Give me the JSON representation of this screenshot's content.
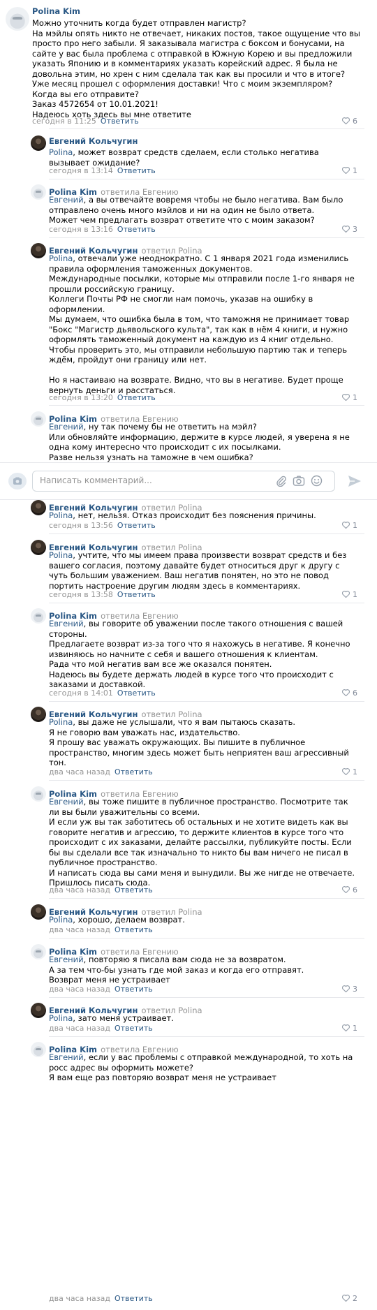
{
  "composer": {
    "placeholder": "Написать комментарий..."
  },
  "comments": [
    {
      "author": "Polina Kim",
      "replied": "",
      "mention": "",
      "text": "Можно уточнить когда будет отправлен магистр?\nНа мэйлы опять никто не отвечает, никаких постов, такое ощущение что вы просто про него забыли. Я заказывала магистра с боксом и бонусами, на сайте у вас была проблема с отправкой в Южную Корею и вы предложили указать Японию и в комментариях указать корейский адрес. Я была не довольна этим, но хрен с ним сделала так как вы просили и что в итоге? Уже месяц прошел с оформления доставки! Что с моим экземпляром? Когда вы его отправите?\nЗаказ 4572654 от 10.01.2021!\nНадеюсь хоть здесь вы мне ответите",
      "time": "сегодня в 11:25",
      "reply": "Ответить",
      "likes": "6"
    },
    {
      "author": "Евгений Кольчугин",
      "replied": "",
      "mention": "Polina",
      "text": ", может возврат средств сделаем, если столько негатива вызывает ожидание?",
      "time": "сегодня в 13:14",
      "reply": "Ответить",
      "likes": "1"
    },
    {
      "author": "Polina Kim",
      "replied": "ответила Евгению",
      "mention": "Евгений",
      "text": ", а вы отвечайте вовремя чтобы не было негатива. Вам было отправлено очень много мэйлов и ни на один не было ответа.\nМожет чем предлагать возврат ответите что с моим заказом?",
      "time": "сегодня в 13:16",
      "reply": "Ответить",
      "likes": "3"
    },
    {
      "author": "Евгений Кольчугин",
      "replied": "ответил Polina",
      "mention": "Polina",
      "text": ", отвечали уже неоднократно. С 1 января 2021 года изменились правила оформления таможенных документов.\nМеждународные посылки, которые мы отправили после 1-го января не прошли российскую границу.\nКоллеги Почты РФ не смогли нам помочь, указав на ошибку в оформлении.\nМы думаем, что ошибка была в том, что таможня не принимает товар \"Бокс \"Магистр дьявольского культа\", так как в нём 4 книги, и нужно оформлять таможенный документ на каждую из 4 книг отдельно.\nЧтобы проверить это, мы отправили небольшую партию так и теперь ждём, пройдут они границу или нет.\n\nНо я настаиваю на возврате. Видно, что вы в негативе. Будет проще вернуть деньги и расстаться.",
      "time": "сегодня в 13:20",
      "reply": "Ответить",
      "likes": "1"
    },
    {
      "author": "Polina Kim",
      "replied": "ответила Евгению",
      "mention": "Евгений",
      "text": ", ну так почему бы не ответить на мэйл?\nИли обновляйте информацию, держите в курсе людей, я уверена я не одна кому интересно что происходит с их посылками.\nРазве нельзя узнать на таможне в чем ошибка?",
      "time": "",
      "reply": "",
      "likes": ""
    },
    {
      "author": "Евгений Кольчугин",
      "replied": "ответил Polina",
      "mention": "Polina",
      "text": ", нет, нельзя. Отказ происходит без пояснения причины.",
      "time": "сегодня в 13:56",
      "reply": "Ответить",
      "likes": "1"
    },
    {
      "author": "Евгений Кольчугин",
      "replied": "ответил Polina",
      "mention": "Polina",
      "text": ", учтите, что мы имеем права произвести возврат средств и без вашего согласия, поэтому давайте будет относиться друг к другу с чуть большим уважением. Ваш негатив понятен, но это не повод портить настроение другим людям здесь в комментариях.",
      "time": "сегодня в 13:58",
      "reply": "Ответить",
      "likes": "1"
    },
    {
      "author": "Polina Kim",
      "replied": "ответила Евгению",
      "mention": "Евгений",
      "text": ", вы говорите об уважении после такого отношения с вашей стороны.\nПредлагаете возврат из-за того что я нахожусь в негативе. Я конечно извиняюсь но начните с себя и вашего отношения к клиентам.\nРада что мой негатив вам все же оказался понятен.\nНадеюсь вы будете держать людей в курсе того что происходит с заказами и доставкой.",
      "time": "сегодня в 14:01",
      "reply": "Ответить",
      "likes": "6"
    },
    {
      "author": "Евгений Кольчугин",
      "replied": "ответил Polina",
      "mention": "Polina",
      "text": ", вы даже не услышали, что я вам пытаюсь сказать.\nЯ не говорю вам уважать нас, издательство.\nЯ прошу вас уважать окружающих. Вы пишите в публичное пространство, многим здесь может быть неприятен ваш агрессивный тон.",
      "time": "два часа назад",
      "reply": "Ответить",
      "likes": "1"
    },
    {
      "author": "Polina Kim",
      "replied": "ответила Евгению",
      "mention": "Евгений",
      "text": ", вы тоже пишите в публичное пространство. Посмотрите так ли вы были уважительны со всеми.\nИ если уж вы так заботитесь об остальных и не хотите видеть как вы говорите негатив и агрессию, то держите клиентов в курсе того что происходит с их заказами, делайте рассылки, публикуйте посты. Если бы вы сделали все так изначально то никто бы вам ничего не писал в публичное пространство.\nИ написать сюда вы сами меня и вынудили. Вы же нигде не отвечаете. Пришлось писать сюда.",
      "time": "два часа назад",
      "reply": "Ответить",
      "likes": "6"
    },
    {
      "author": "Евгений Кольчугин",
      "replied": "ответил Polina",
      "mention": "Polina",
      "text": ", хорошо, делаем возврат.",
      "time": "два часа назад",
      "reply": "Ответить",
      "likes": ""
    },
    {
      "author": "Polina Kim",
      "replied": "ответила Евгению",
      "mention": "Евгений",
      "text": ", повторяю я писала вам сюда не за возвратом.\nА за тем что-бы узнать где мой заказ и когда его отправят.\nВозврат меня не устраивает",
      "time": "два часа назад",
      "reply": "Ответить",
      "likes": "3"
    },
    {
      "author": "Евгений Кольчугин",
      "replied": "ответил Polina",
      "mention": "Polina",
      "text": ", зато меня устраивает.",
      "time": "два часа назад",
      "reply": "Ответить",
      "likes": "1"
    },
    {
      "author": "Polina Kim",
      "replied": "ответила Евгению",
      "mention": "Евгений",
      "text": ", если у вас проблемы с отправкой международной, то хоть на росс адрес вы оформить можете?\nЯ вам еще раз повторяю возврат меня не устраивает",
      "time": "два часа назад",
      "reply": "Ответить",
      "likes": "2"
    }
  ]
}
